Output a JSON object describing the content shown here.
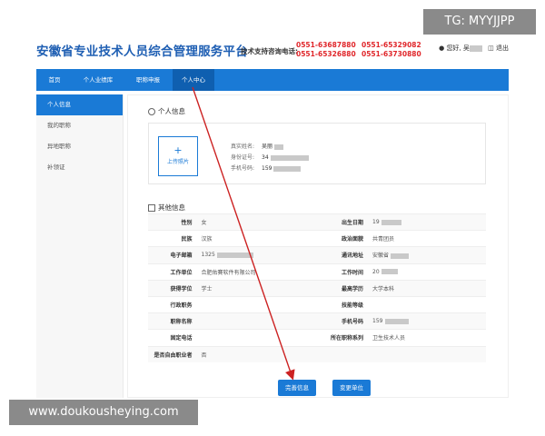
{
  "header": {
    "brand": "安徽省专业技术人员综合管理服务平台",
    "support_label": "技术支持咨询电话:",
    "phones": [
      "0551-63687880",
      "0551-65329082",
      "0551-65326880",
      "0551-63730880"
    ],
    "greeting": "您好,",
    "user_name": "吴",
    "logout": "退出"
  },
  "nav": {
    "items": [
      {
        "label": "首页"
      },
      {
        "label": "个人业绩库"
      },
      {
        "label": "职称申报"
      },
      {
        "label": "个人中心"
      }
    ],
    "active_index": 3
  },
  "sidebar": {
    "items": [
      {
        "label": "个人信息"
      },
      {
        "label": "我的职称"
      },
      {
        "label": "异地职称"
      },
      {
        "label": "补领证"
      }
    ],
    "active_index": 0
  },
  "personal": {
    "title": "个人信息",
    "upload_plus": "+",
    "upload_label": "上传照片",
    "fields": [
      {
        "label": "真实姓名:",
        "value": "吴丽"
      },
      {
        "label": "身份证号:",
        "value": "34"
      },
      {
        "label": "手机号码:",
        "value": "159"
      }
    ]
  },
  "other": {
    "title": "其他信息",
    "rows": [
      {
        "l1": "性别",
        "v1": "女",
        "l2": "出生日期",
        "v2": "19"
      },
      {
        "l1": "民族",
        "v1": "汉族",
        "l2": "政治面貌",
        "v2": "共青团员"
      },
      {
        "l1": "电子邮箱",
        "v1": "1325",
        "l2": "通讯地址",
        "v2": "安徽省"
      },
      {
        "l1": "工作单位",
        "v1": "合肥佑賽软件有限公司",
        "l2": "工作时间",
        "v2": "20"
      },
      {
        "l1": "获得学位",
        "v1": "学士",
        "l2": "最高学历",
        "v2": "大学本科"
      },
      {
        "l1": "行政职务",
        "v1": "",
        "l2": "技能等级",
        "v2": ""
      },
      {
        "l1": "职称名称",
        "v1": "",
        "l2": "手机号码",
        "v2": "159"
      },
      {
        "l1": "固定电话",
        "v1": "",
        "l2": "所在职称系列",
        "v2": "卫生技术人员"
      },
      {
        "l1": "是否自由职业者",
        "v1": "否",
        "l2": "",
        "v2": ""
      }
    ]
  },
  "buttons": {
    "complete": "完善信息",
    "change_unit": "变更单位"
  },
  "watermarks": {
    "top": "TG: MYYJJPP",
    "bottom": "www.doukousheying.com"
  },
  "colors": {
    "brand_blue": "#1f5fb3",
    "nav_blue": "#1a7ad6",
    "phone_red": "#e0262a",
    "arrow_red": "#cc2222"
  }
}
